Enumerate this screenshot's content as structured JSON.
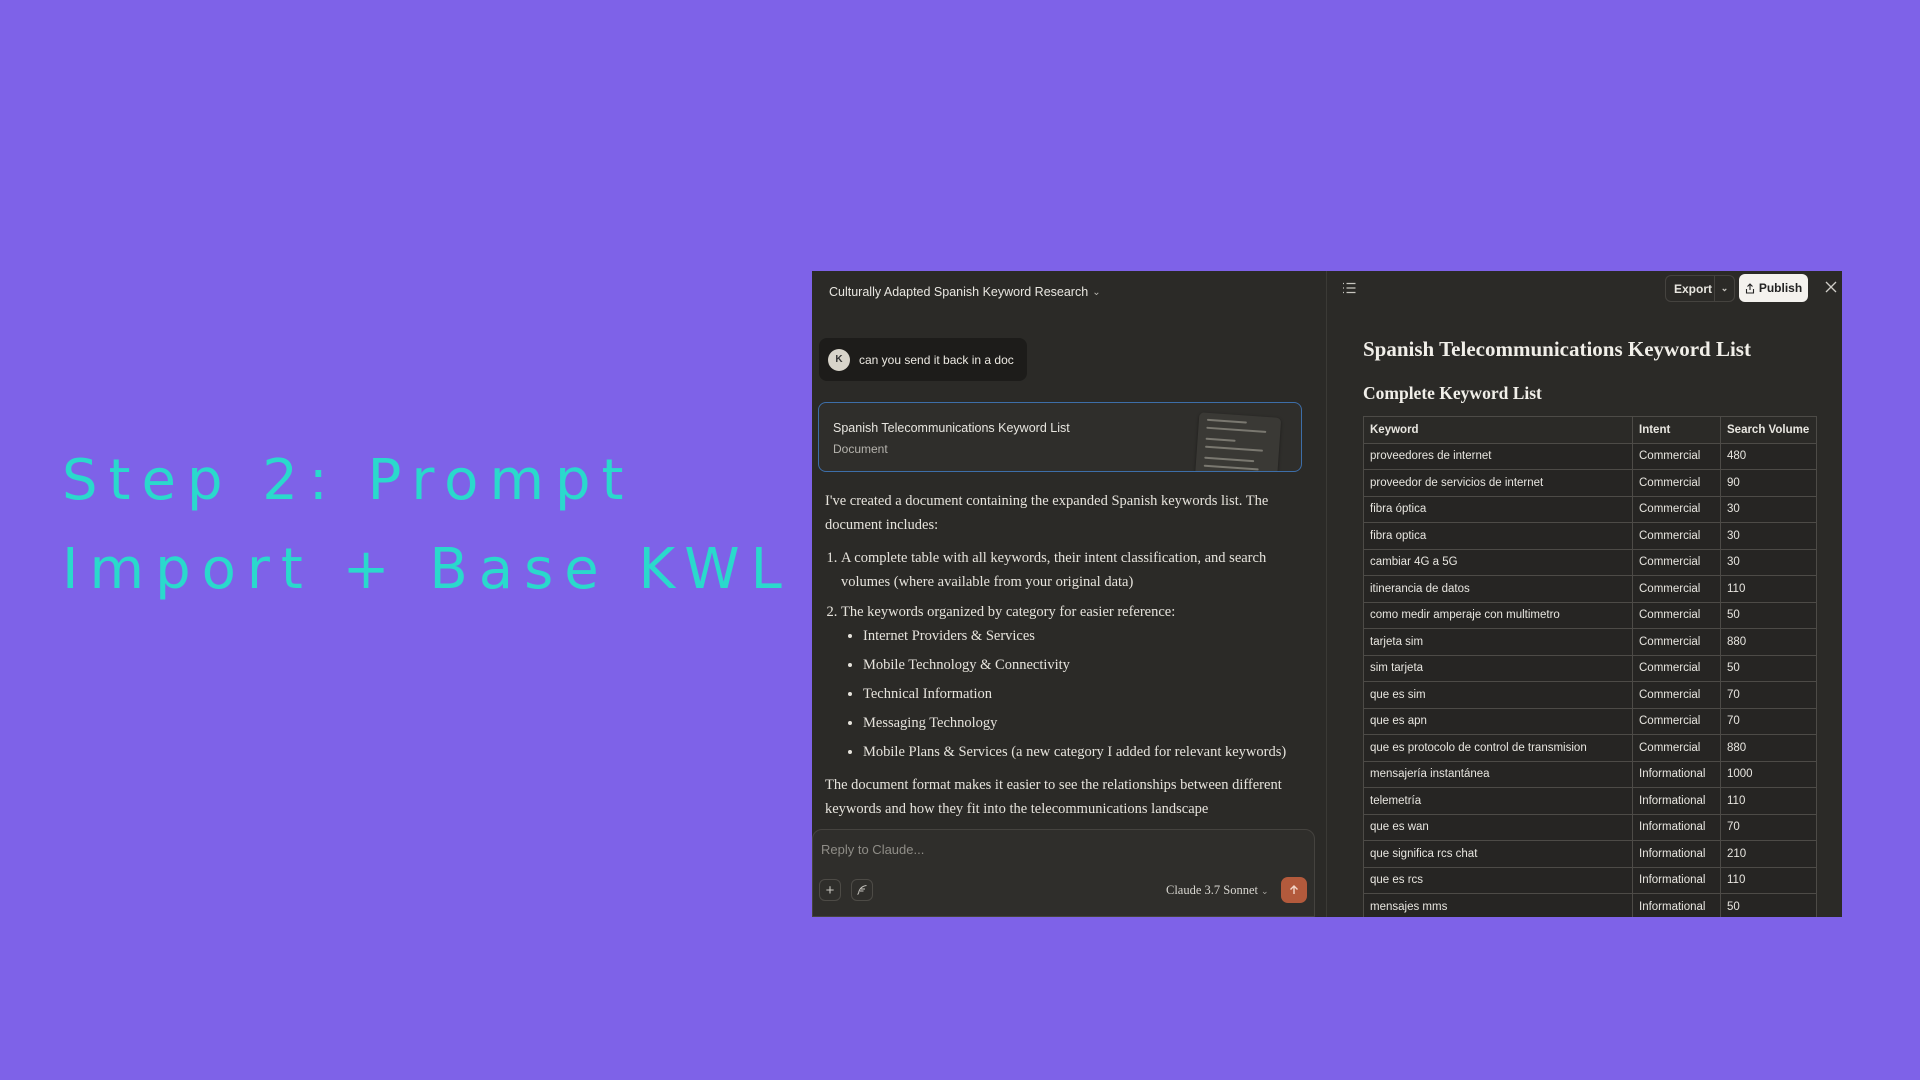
{
  "slide": {
    "title_line1": "Step 2: Prompt",
    "title_line2": "Import + Base KWL"
  },
  "chat": {
    "conversation_title": "Culturally Adapted Spanish Keyword Research",
    "user_initial": "K",
    "user_message": "can you send it back in a doc",
    "artifact": {
      "title": "Spanish Telecommunications Keyword List",
      "type": "Document"
    },
    "response": {
      "intro": "I've created a document containing the expanded Spanish keywords list. The document includes:",
      "points": [
        "A complete table with all keywords, their intent classification, and search volumes (where available from your original data)",
        "The keywords organized by category for easier reference:"
      ],
      "categories": [
        "Internet Providers & Services",
        "Mobile Technology & Connectivity",
        "Technical Information",
        "Messaging Technology",
        "Mobile Plans & Services (a new category I added for relevant keywords)"
      ],
      "closing": "The document format makes it easier to see the relationships between different keywords and how they fit into the telecommunications landscape"
    },
    "composer": {
      "placeholder": "Reply to Claude...",
      "model": "Claude 3.7 Sonnet"
    }
  },
  "document": {
    "export_label": "Export",
    "publish_label": "Publish",
    "heading": "Spanish Telecommunications Keyword List",
    "subheading": "Complete Keyword List",
    "columns": [
      "Keyword",
      "Intent",
      "Search Volume"
    ],
    "rows": [
      [
        "proveedores de internet",
        "Commercial",
        "480"
      ],
      [
        "proveedor de servicios de internet",
        "Commercial",
        "90"
      ],
      [
        "fibra óptica",
        "Commercial",
        "30"
      ],
      [
        "fibra optica",
        "Commercial",
        "30"
      ],
      [
        "cambiar 4G a 5G",
        "Commercial",
        "30"
      ],
      [
        "itinerancia de datos",
        "Commercial",
        "110"
      ],
      [
        "como medir amperaje con multimetro",
        "Commercial",
        "50"
      ],
      [
        "tarjeta sim",
        "Commercial",
        "880"
      ],
      [
        "sim tarjeta",
        "Commercial",
        "50"
      ],
      [
        "que es sim",
        "Commercial",
        "70"
      ],
      [
        "que es apn",
        "Commercial",
        "70"
      ],
      [
        "que es protocolo de control de transmision",
        "Commercial",
        "880"
      ],
      [
        "mensajería instantánea",
        "Informational",
        "1000"
      ],
      [
        "telemetría",
        "Informational",
        "110"
      ],
      [
        "que es wan",
        "Informational",
        "70"
      ],
      [
        "que significa rcs chat",
        "Informational",
        "210"
      ],
      [
        "que es rcs",
        "Informational",
        "110"
      ],
      [
        "mensajes mms",
        "Informational",
        "50"
      ]
    ]
  }
}
